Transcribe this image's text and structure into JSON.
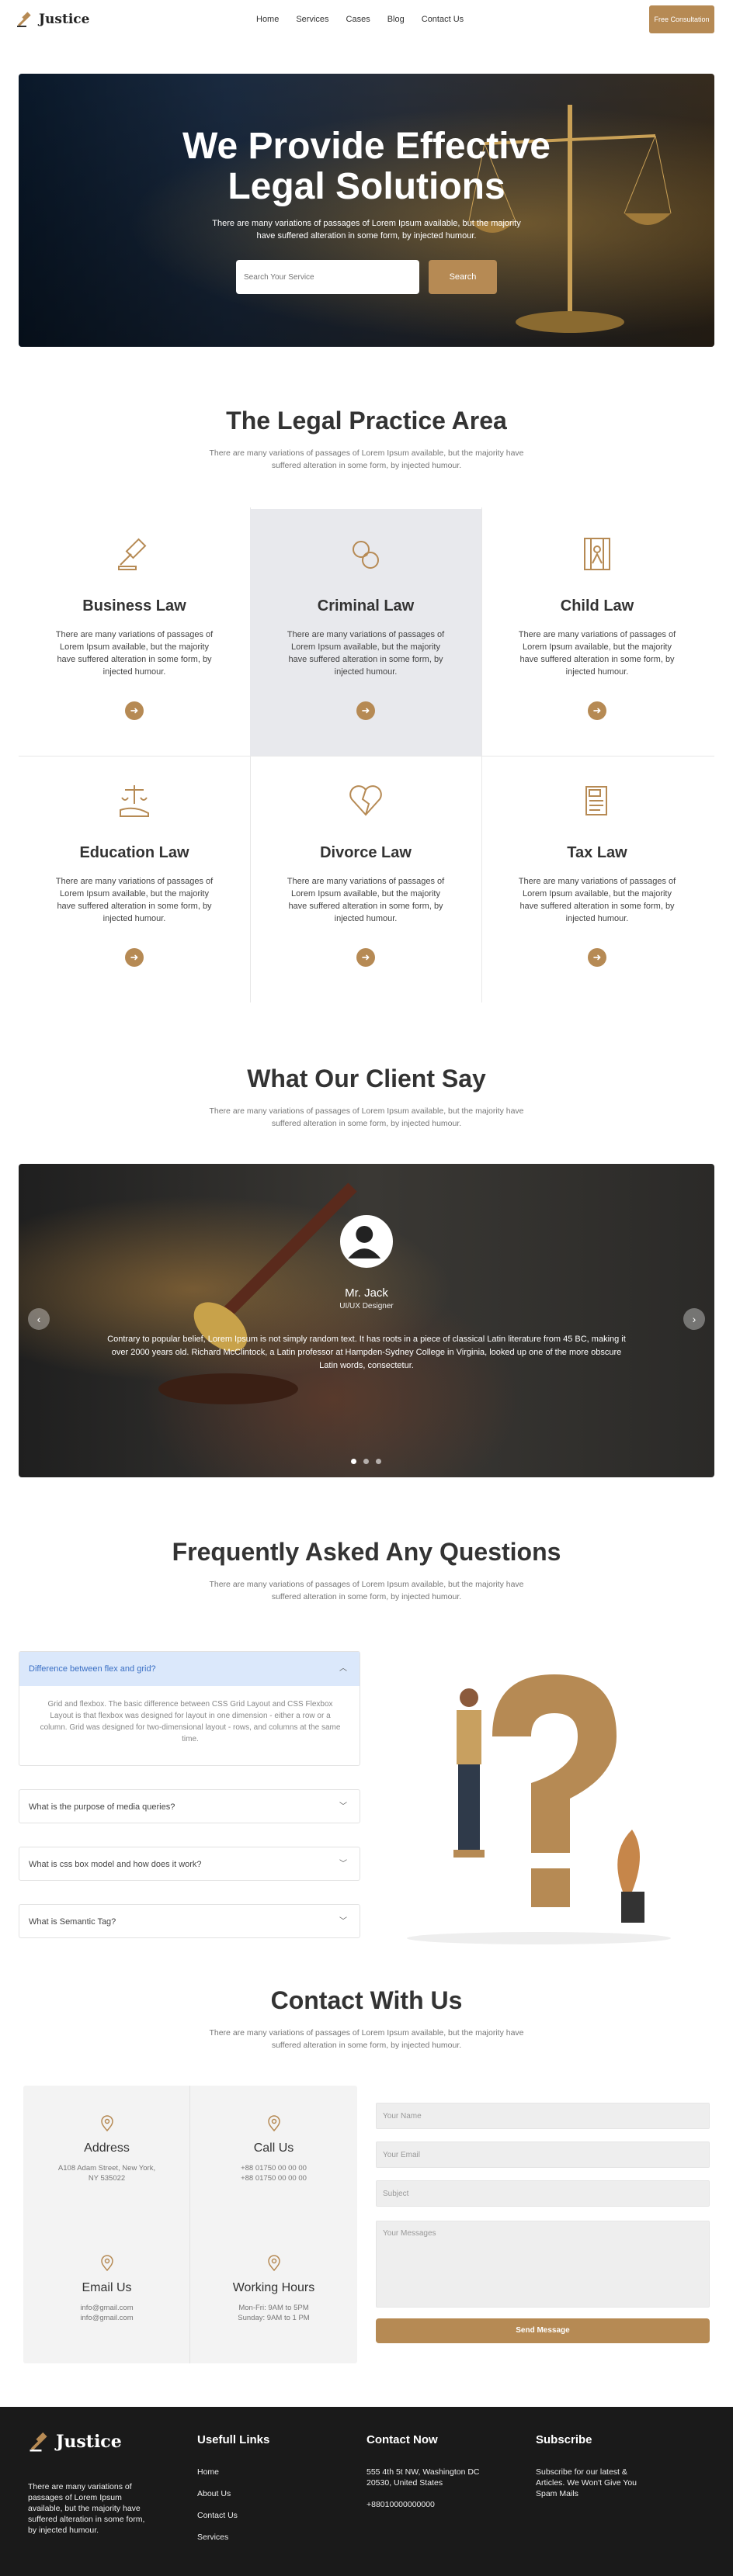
{
  "nav": {
    "brand": "Justice",
    "menu": [
      "Home",
      "Services",
      "Cases",
      "Blog",
      "Contact Us"
    ],
    "cta": "Free Consultation"
  },
  "hero": {
    "title_line1": "We Provide Effective",
    "title_line2": "Legal Solutions",
    "subtitle": "There are many variations of passages of Lorem Ipsum available, but the majority have suffered alteration in some form, by injected humour.",
    "search_placeholder": "Search Your Service",
    "search_button": "Search"
  },
  "practice": {
    "title": "The Legal Practice Area",
    "subtitle": "There are many variations of passages of Lorem Ipsum available, but the majority have suffered alteration in some form, by injected humour.",
    "cards": [
      {
        "title": "Business Law",
        "text": "There are many variations of passages of Lorem Ipsum available, but the majority have suffered alteration in some form, by injected humour.",
        "icon": "gavel-icon"
      },
      {
        "title": "Criminal Law",
        "text": "There are many variations of passages of Lorem Ipsum available, but the majority have suffered alteration in some form, by injected humour.",
        "icon": "handcuffs-icon"
      },
      {
        "title": "Child Law",
        "text": "There are many variations of passages of Lorem Ipsum available, but the majority have suffered alteration in some form, by injected humour.",
        "icon": "child-icon"
      },
      {
        "title": "Education Law",
        "text": "There are many variations of passages of Lorem Ipsum available, but the majority have suffered alteration in some form, by injected humour.",
        "icon": "scales-hand-icon"
      },
      {
        "title": "Divorce Law",
        "text": "There are many variations of passages of Lorem Ipsum available, but the majority have suffered alteration in some form, by injected humour.",
        "icon": "broken-heart-icon"
      },
      {
        "title": "Tax Law",
        "text": "There are many variations of passages of Lorem Ipsum available, but the majority have suffered alteration in some form, by injected humour.",
        "icon": "tax-document-icon"
      }
    ]
  },
  "testimonials": {
    "title": "What Our Client Say",
    "subtitle": "There are many variations of passages of Lorem Ipsum available, but the majority have suffered alteration in some form, by injected humour.",
    "name": "Mr. Jack",
    "role": "UI/UX Designer",
    "quote": "Contrary to popular belief, Lorem Ipsum is not simply random text. It has roots in a piece of classical Latin literature from 45 BC, making it over 2000 years old. Richard McClintock, a Latin professor at Hampden-Sydney College in Virginia, looked up one of the more obscure Latin words, consectetur."
  },
  "faq": {
    "title": "Frequently Asked Any Questions",
    "subtitle": "There are many variations of passages of Lorem Ipsum available, but the majority have suffered alteration in some form, by injected humour.",
    "items": [
      {
        "q": "Difference between flex and grid?",
        "a": "Grid and flexbox. The basic difference between CSS Grid Layout and CSS Flexbox Layout is that flexbox was designed for layout in one dimension - either a row or a column. Grid was designed for two-dimensional layout - rows, and columns at the same time."
      },
      {
        "q": "What is the purpose of media queries?"
      },
      {
        "q": "What is css box model and how does it work?"
      },
      {
        "q": "What is Semantic Tag?"
      }
    ]
  },
  "contact": {
    "title": "Contact With Us",
    "subtitle": "There are many variations of passages of Lorem Ipsum available, but the majority have suffered alteration in some form, by injected humour.",
    "address": {
      "title": "Address",
      "l1": "A108 Adam Street, New York,",
      "l2": "NY 535022"
    },
    "call": {
      "title": "Call Us",
      "l1": "+88 01750 00 00 00",
      "l2": "+88 01750 00 00 00"
    },
    "email": {
      "title": "Email Us",
      "l1": "info@gmail.com",
      "l2": "info@gmail.com"
    },
    "hours": {
      "title": "Working Hours",
      "l1": "Mon-Fri: 9AM to 5PM",
      "l2": "Sunday: 9AM to 1 PM"
    },
    "form": {
      "name": "Your Name",
      "email": "Your Email",
      "subject": "Subject",
      "message": "Your Messages",
      "send": "Send Message"
    }
  },
  "footer": {
    "brand": "Justice",
    "about": "There are many variations of passages of Lorem Ipsum available, but the majority have suffered alteration in some form, by injected humour.",
    "links_title": "Usefull Links",
    "links": [
      "Home",
      "About Us",
      "Contact Us",
      "Services"
    ],
    "contact_title": "Contact Now",
    "address": "555 4th 5t NW, Washington DC 20530, United States",
    "phone": "+88010000000000",
    "subscribe_title": "Subscribe",
    "subscribe_text": "Subscribe for our latest & Articles. We Won't Give You Spam Mails"
  },
  "colors": {
    "accent": "#b68a54",
    "footer": "#1a1a1a",
    "active_faq": "#dbe8fb"
  }
}
